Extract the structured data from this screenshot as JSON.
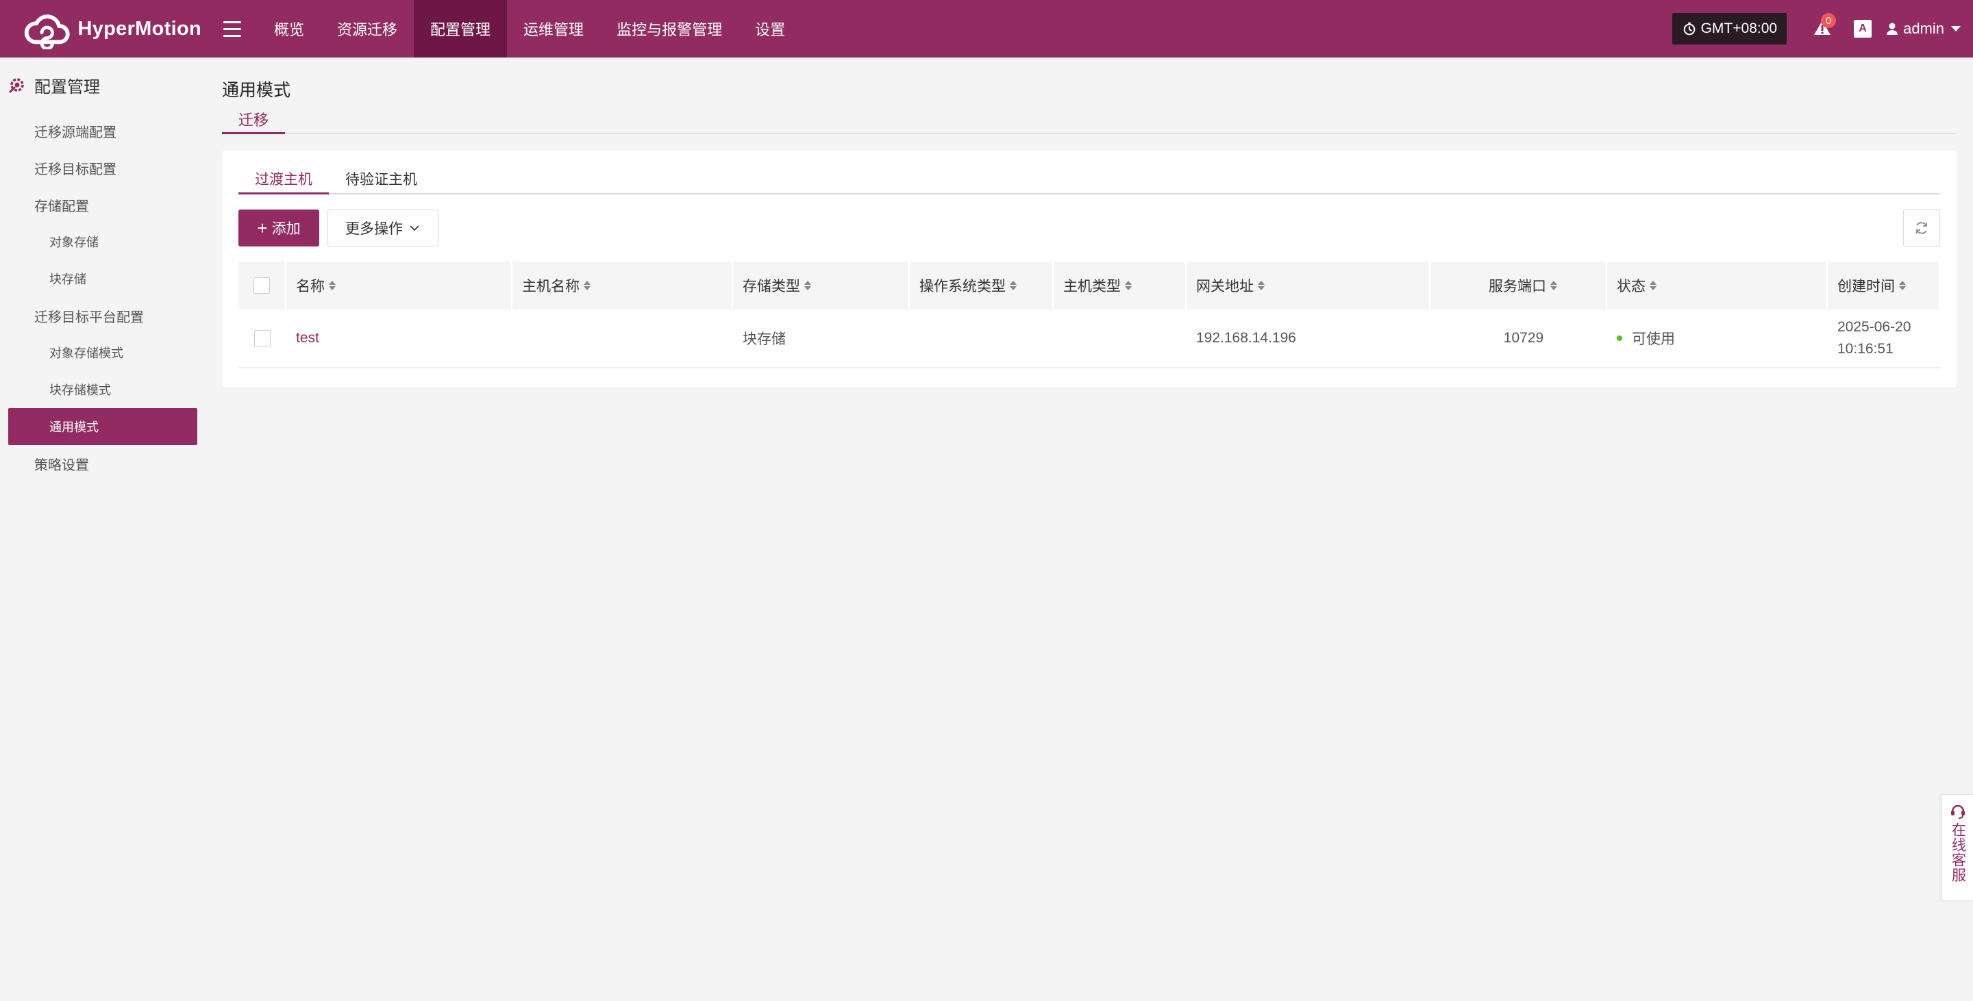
{
  "brand": {
    "name": "HyperMotion",
    "accent": "#922b61",
    "accent_dark": "#6e1747"
  },
  "nav": {
    "items": [
      {
        "label": "概览"
      },
      {
        "label": "资源迁移"
      },
      {
        "label": "配置管理",
        "active": true
      },
      {
        "label": "运维管理"
      },
      {
        "label": "监控与报警管理"
      },
      {
        "label": "设置"
      }
    ]
  },
  "topbar": {
    "timezone": "GMT+08:00",
    "alert_count": "0",
    "lang_icon": "A",
    "user": "admin"
  },
  "sidebar": {
    "title": "配置管理",
    "items": [
      {
        "label": "迁移源端配置",
        "level": 1
      },
      {
        "label": "迁移目标配置",
        "level": 1
      },
      {
        "label": "存储配置",
        "level": 1
      },
      {
        "label": "对象存储",
        "level": 2
      },
      {
        "label": "块存储",
        "level": 2
      },
      {
        "label": "迁移目标平台配置",
        "level": 1
      },
      {
        "label": "对象存储模式",
        "level": 2
      },
      {
        "label": "块存储模式",
        "level": 2
      },
      {
        "label": "通用模式",
        "level": 2,
        "active": true
      },
      {
        "label": "策略设置",
        "level": 1
      }
    ]
  },
  "main": {
    "title": "通用模式",
    "top_tab": "迁移",
    "sub_tabs": [
      "过渡主机",
      "待验证主机"
    ],
    "toolbar": {
      "add_label": "添加",
      "more_label": "更多操作"
    },
    "table": {
      "columns": [
        "名称",
        "主机名称",
        "存储类型",
        "操作系统类型",
        "主机类型",
        "网关地址",
        "服务端口",
        "状态",
        "创建时间"
      ],
      "rows": [
        {
          "name": "test",
          "host_name": "",
          "storage_type": "块存储",
          "os_type": "",
          "host_type": "",
          "gateway": "192.168.14.196",
          "port": "10729",
          "status": "可使用",
          "status_color": "#52c41a",
          "created_date": "2025-06-20",
          "created_time": "10:16:51"
        }
      ]
    }
  },
  "service": {
    "label": "在线客服"
  }
}
